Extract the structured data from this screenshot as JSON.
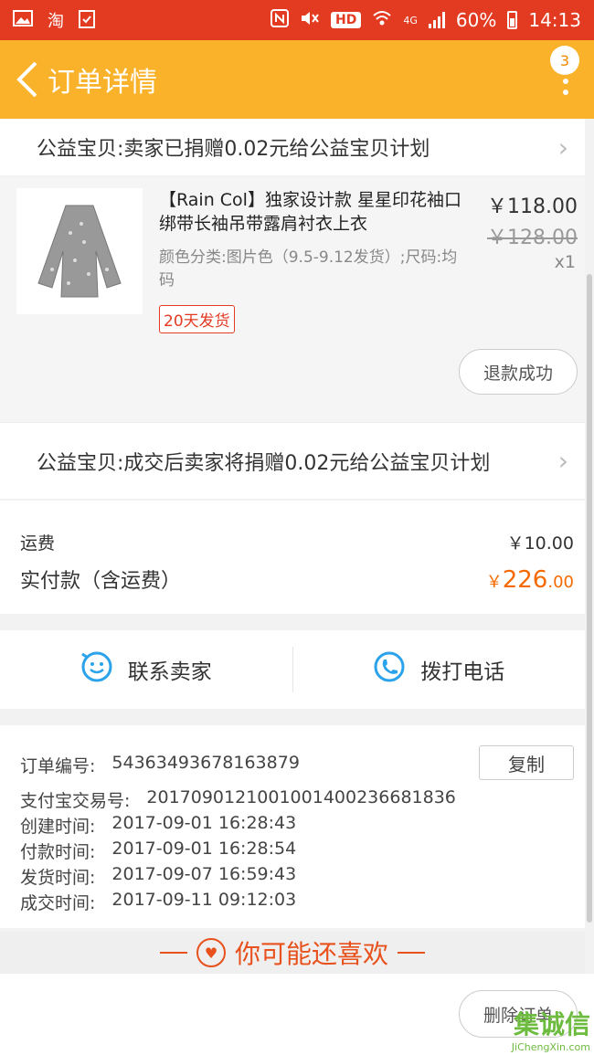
{
  "statusbar": {
    "taobao_label": "淘",
    "hd": "HD",
    "network": "4G",
    "battery": "60%",
    "time": "14:13"
  },
  "nav": {
    "title": "订单详情",
    "badge_count": "3"
  },
  "charity_top": "公益宝贝:卖家已捐赠0.02元给公益宝贝计划",
  "product": {
    "title": "【Rain Col】独家设计款 星星印花袖口绑带长袖吊带露肩衬衣上衣",
    "sku": "颜色分类:图片色（9.5-9.12发货）;尺码:均码",
    "ship_tag": "20天发货",
    "price": "￥118.00",
    "original_price": "￥128.00",
    "qty": "x1",
    "refund_label": "退款成功"
  },
  "charity_bottom": "公益宝贝:成交后卖家将捐赠0.02元给公益宝贝计划",
  "fees": {
    "shipping_label": "运费",
    "shipping_value": "￥10.00",
    "total_label": "实付款（含运费）",
    "total_symbol": "￥",
    "total_int": "226",
    "total_dec": ".00"
  },
  "contact": {
    "seller_label": "联系卖家",
    "phone_label": "拨打电话"
  },
  "order_info": {
    "copy_label": "复制",
    "rows": [
      {
        "label": "订单编号:",
        "value": "54363493678163879"
      },
      {
        "label": "支付宝交易号:",
        "value": "2017090121001001400236681836"
      },
      {
        "label": "创建时间:",
        "value": "2017-09-01 16:28:43"
      },
      {
        "label": "付款时间:",
        "value": "2017-09-01 16:28:54"
      },
      {
        "label": "发货时间:",
        "value": "2017-09-07 16:59:43"
      },
      {
        "label": "成交时间:",
        "value": "2017-09-11 09:12:03"
      }
    ]
  },
  "guess_title": "你可能还喜欢",
  "bottom": {
    "delete_label": "删除订单"
  },
  "watermark": {
    "main": "集诚信",
    "sub": "JiChengXin.com"
  },
  "colors": {
    "statusbar": "#e33b22",
    "navbar": "#f9b22a",
    "accent_orange": "#f56a00",
    "icon_blue": "#2aa3ea"
  }
}
